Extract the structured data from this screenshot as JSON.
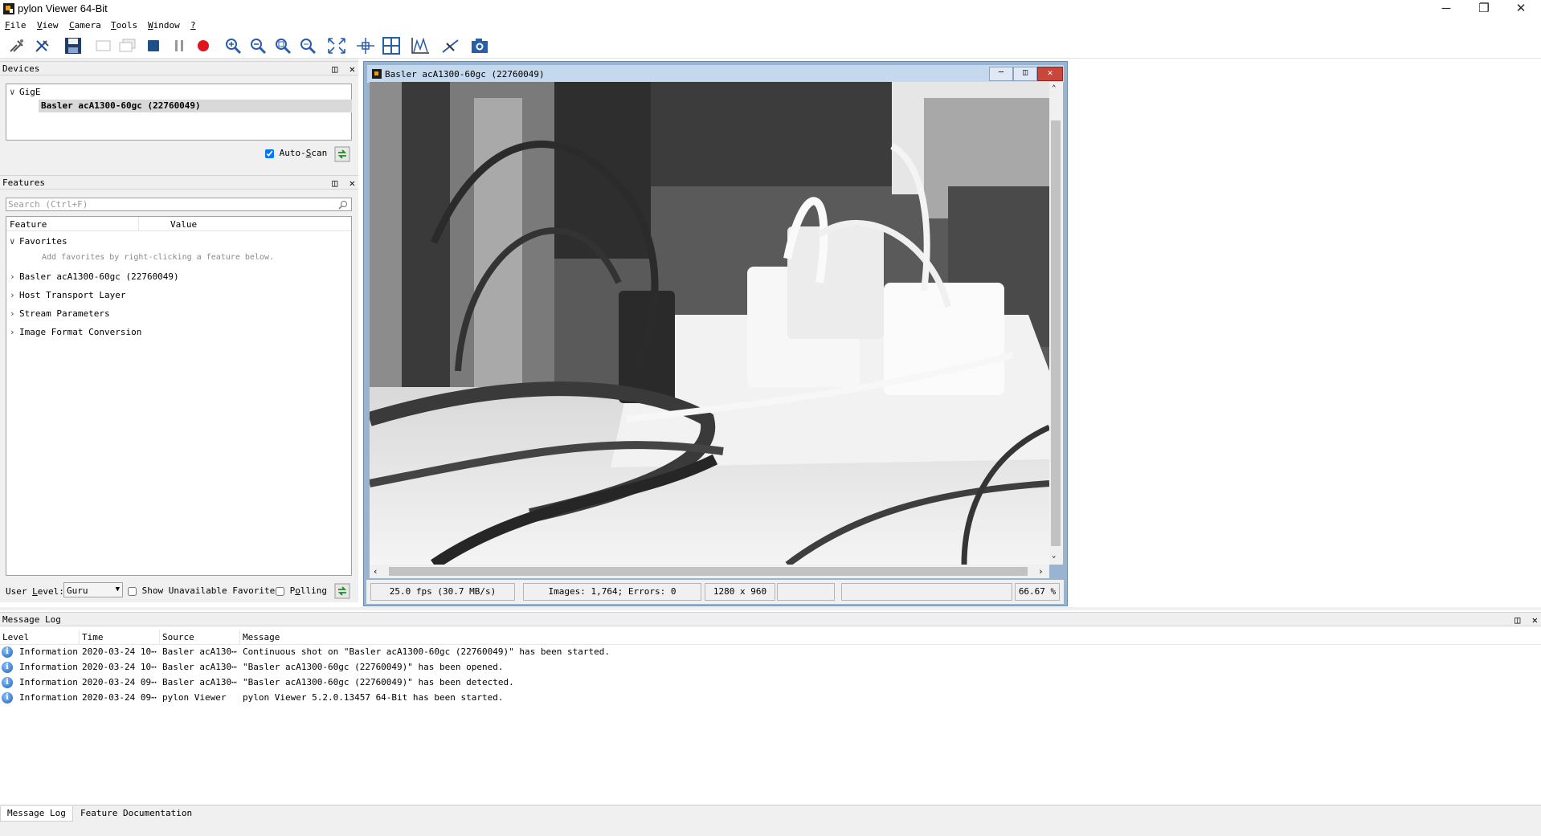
{
  "window": {
    "title": "pylon Viewer 64-Bit",
    "minimize_glyph": "─",
    "restore_glyph": "❐",
    "close_glyph": "✕"
  },
  "menu": [
    {
      "key": "F",
      "rest": "ile"
    },
    {
      "key": "V",
      "rest": "iew"
    },
    {
      "key": "C",
      "rest": "amera"
    },
    {
      "key": "T",
      "rest": "ools"
    },
    {
      "key": "W",
      "rest": "indow"
    },
    {
      "key": "?",
      "rest": ""
    }
  ],
  "toolbar": {
    "icons": [
      "open-camera-icon",
      "close-camera-icon",
      "save-icon",
      "single-shot-icon",
      "continuous-shot-icon",
      "stop-icon",
      "pause-icon",
      "record-icon",
      "zoom-in-icon",
      "zoom-out-icon",
      "zoom-fit-icon",
      "zoom-100-icon",
      "fullscreen-icon",
      "center-crosshair-icon",
      "grid-icon",
      "histogram-icon",
      "line-profile-icon",
      "camera-snapshot-icon"
    ]
  },
  "devices": {
    "title": "Devices",
    "group": "GigE",
    "selected_device": "Basler acA1300-60gc (22760049)",
    "auto_scan_label": "Auto-Scan",
    "auto_scan_key": "S",
    "auto_scan_checked": true
  },
  "features": {
    "title": "Features",
    "search_placeholder": "Search (Ctrl+F)",
    "col_feature": "Feature",
    "col_value": "Value",
    "favorites": "Favorites",
    "favorites_hint": "Add favorites by right-clicking a feature below.",
    "categories": [
      "Basler acA1300-60gc (22760049)",
      "Host Transport Layer",
      "Stream Parameters",
      "Image Format Conversion"
    ],
    "user_level_label": "User Level:",
    "user_level_key": "L",
    "user_level_value": "Guru",
    "show_unavailable_label": "Show Unavailable Favorites",
    "polling_label": "Polling",
    "polling_key": "o"
  },
  "image_window": {
    "title": "Basler acA1300-60gc (22760049)",
    "status": {
      "fps": "25.0 fps (30.7 MB/s)",
      "images": "Images: 1,764; Errors: 0",
      "resolution": "1280 x 960",
      "empty1": "",
      "empty2": "",
      "zoom": "66.67 %"
    }
  },
  "message_log": {
    "title": "Message Log",
    "columns": [
      "Level",
      "Time",
      "Source",
      "Message"
    ],
    "rows": [
      {
        "level": "Information",
        "time": "2020-03-24 10⋯",
        "source": "Basler acA130⋯",
        "message": "Continuous shot on \"Basler acA1300-60gc (22760049)\" has been started."
      },
      {
        "level": "Information",
        "time": "2020-03-24 10⋯",
        "source": "Basler acA130⋯",
        "message": "\"Basler acA1300-60gc (22760049)\" has been opened."
      },
      {
        "level": "Information",
        "time": "2020-03-24 09⋯",
        "source": "Basler acA130⋯",
        "message": "\"Basler acA1300-60gc (22760049)\" has been detected."
      },
      {
        "level": "Information",
        "time": "2020-03-24 09⋯",
        "source": "pylon Viewer",
        "message": "pylon Viewer 5.2.0.13457 64-Bit has been started."
      }
    ]
  },
  "bottom_tabs": [
    "Message Log",
    "Feature Documentation"
  ]
}
